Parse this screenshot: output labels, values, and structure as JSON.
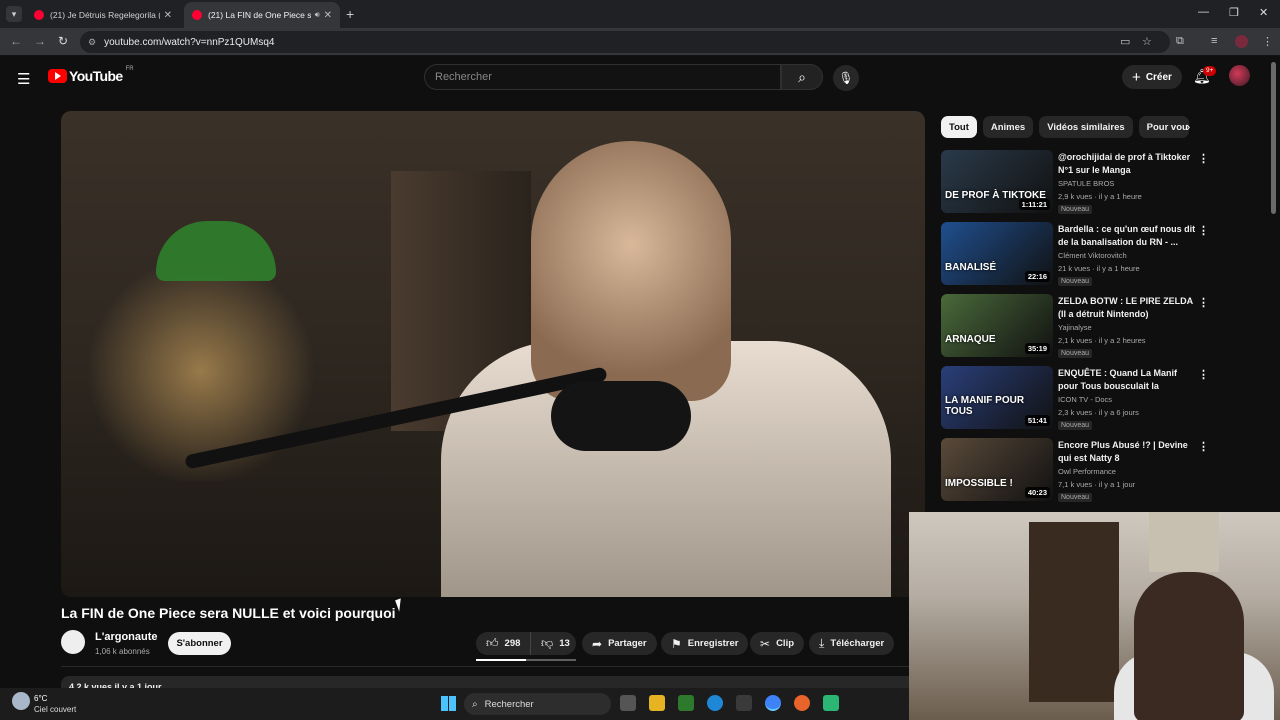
{
  "browser": {
    "tabs": [
      {
        "title": "(21) Je Détruis Regelegorila (ne"
      },
      {
        "title": "(21) La FIN de One Piece se"
      }
    ],
    "new_tab_label": "+",
    "url": "youtube.com/watch?v=nnPz1QUMsq4"
  },
  "youtube": {
    "logo_text": "YouTube",
    "country_code": "FR",
    "search_placeholder": "Rechercher",
    "create_label": "Créer",
    "notif_count": "9+"
  },
  "video": {
    "title": "La FIN de One Piece sera NULLE et voici pourquoi",
    "channel": "L'argonaute",
    "subscribers": "1,06 k abonnés",
    "subscribe_label": "S'abonner",
    "likes": "298",
    "dislikes": "13",
    "like_ratio": 0.5,
    "share_label": "Partager",
    "save_label": "Enregistrer",
    "clip_label": "Clip",
    "download_label": "Télécharger",
    "description_stats": "4,2 k vues  il y a 1 jour"
  },
  "chips": [
    "Tout",
    "Animes",
    "Vidéos similaires",
    "Pour vou"
  ],
  "recommendations": [
    {
      "title": "@orochijidai de prof à Tiktoker N°1 sur le Manga",
      "channel": "SPATULE BROS",
      "meta": "2,9 k vues · il y a 1 heure",
      "badge": "Nouveau",
      "duration": "1:11:21",
      "thumb_caption": "DE PROF À TIKTOKE",
      "color": "#2a3a4a"
    },
    {
      "title": "Bardella : ce qu'un œuf nous dit de la banalisation du RN - ...",
      "channel": "Clément Viktorovitch",
      "meta": "21 k vues · il y a 1 heure",
      "badge": "Nouveau",
      "duration": "22:16",
      "thumb_caption": "BANALISÉ",
      "color": "#1f4f8f"
    },
    {
      "title": "ZELDA BOTW : LE PIRE ZELDA (Il a détruit Nintendo)",
      "channel": "Yajinalyse",
      "meta": "2,1 k vues · il y a 2 heures",
      "badge": "Nouveau",
      "duration": "35:19",
      "thumb_caption": "ARNAQUE",
      "color": "#4a6a3a"
    },
    {
      "title": "ENQUÊTE : Quand La Manif pour Tous bousculait la France...",
      "channel": "ICON TV - Docs",
      "meta": "2,3 k vues · il y a 6 jours",
      "badge": "Nouveau",
      "duration": "51:41",
      "thumb_caption": "LA MANIF POUR TOUS",
      "color": "#2a3f7a"
    },
    {
      "title": "Encore Plus Abusé !? | Devine qui est Natty 8",
      "channel": "Owl Performance",
      "meta": "7,1 k vues · il y a 1 jour",
      "badge": "Nouveau",
      "duration": "40:23",
      "thumb_caption": "IMPOSSIBLE !",
      "color": "#5a4a3a"
    }
  ],
  "taskbar": {
    "temperature": "6°C",
    "weather": "Ciel couvert",
    "search_label": "Rechercher"
  },
  "icons": {
    "menu": "hamburger-icon",
    "search": "search-icon",
    "mic": "mic-icon",
    "bell": "bell-icon",
    "like": "thumbs-up-icon",
    "dislike": "thumbs-down-icon",
    "share": "share-icon",
    "save": "bookmark-icon",
    "clip": "scissors-icon",
    "download": "download-icon"
  }
}
